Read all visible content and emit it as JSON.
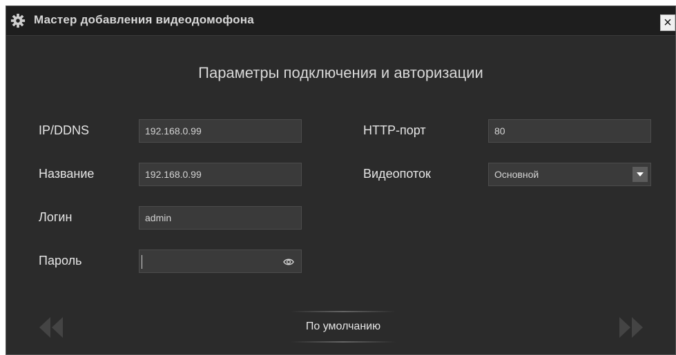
{
  "window": {
    "title": "Мастер добавления видеодомофона",
    "close_glyph": "×",
    "title_icon": "gear-icon"
  },
  "heading": "Параметры подключения и авторизации",
  "form": {
    "ip": {
      "label": "IP/DDNS",
      "value": "192.168.0.99"
    },
    "name": {
      "label": "Название",
      "value": "192.168.0.99"
    },
    "login": {
      "label": "Логин",
      "value": "admin"
    },
    "password": {
      "label": "Пароль",
      "value": "",
      "toggle_icon": "eye-icon"
    },
    "http_port": {
      "label": "HTTP-порт",
      "value": "80"
    },
    "stream": {
      "label": "Видеопоток",
      "selected": "Основной"
    }
  },
  "footer": {
    "default_label": "По умолчанию",
    "prev_icon": "double-chevron-left-icon",
    "next_icon": "double-chevron-right-icon"
  },
  "colors": {
    "window_bg": "#2b2b2b",
    "titlebar_bg": "#1e1e1e",
    "field_bg": "#3a3a3a",
    "text": "#e6e6e6",
    "disabled_arrow": "#444444"
  }
}
